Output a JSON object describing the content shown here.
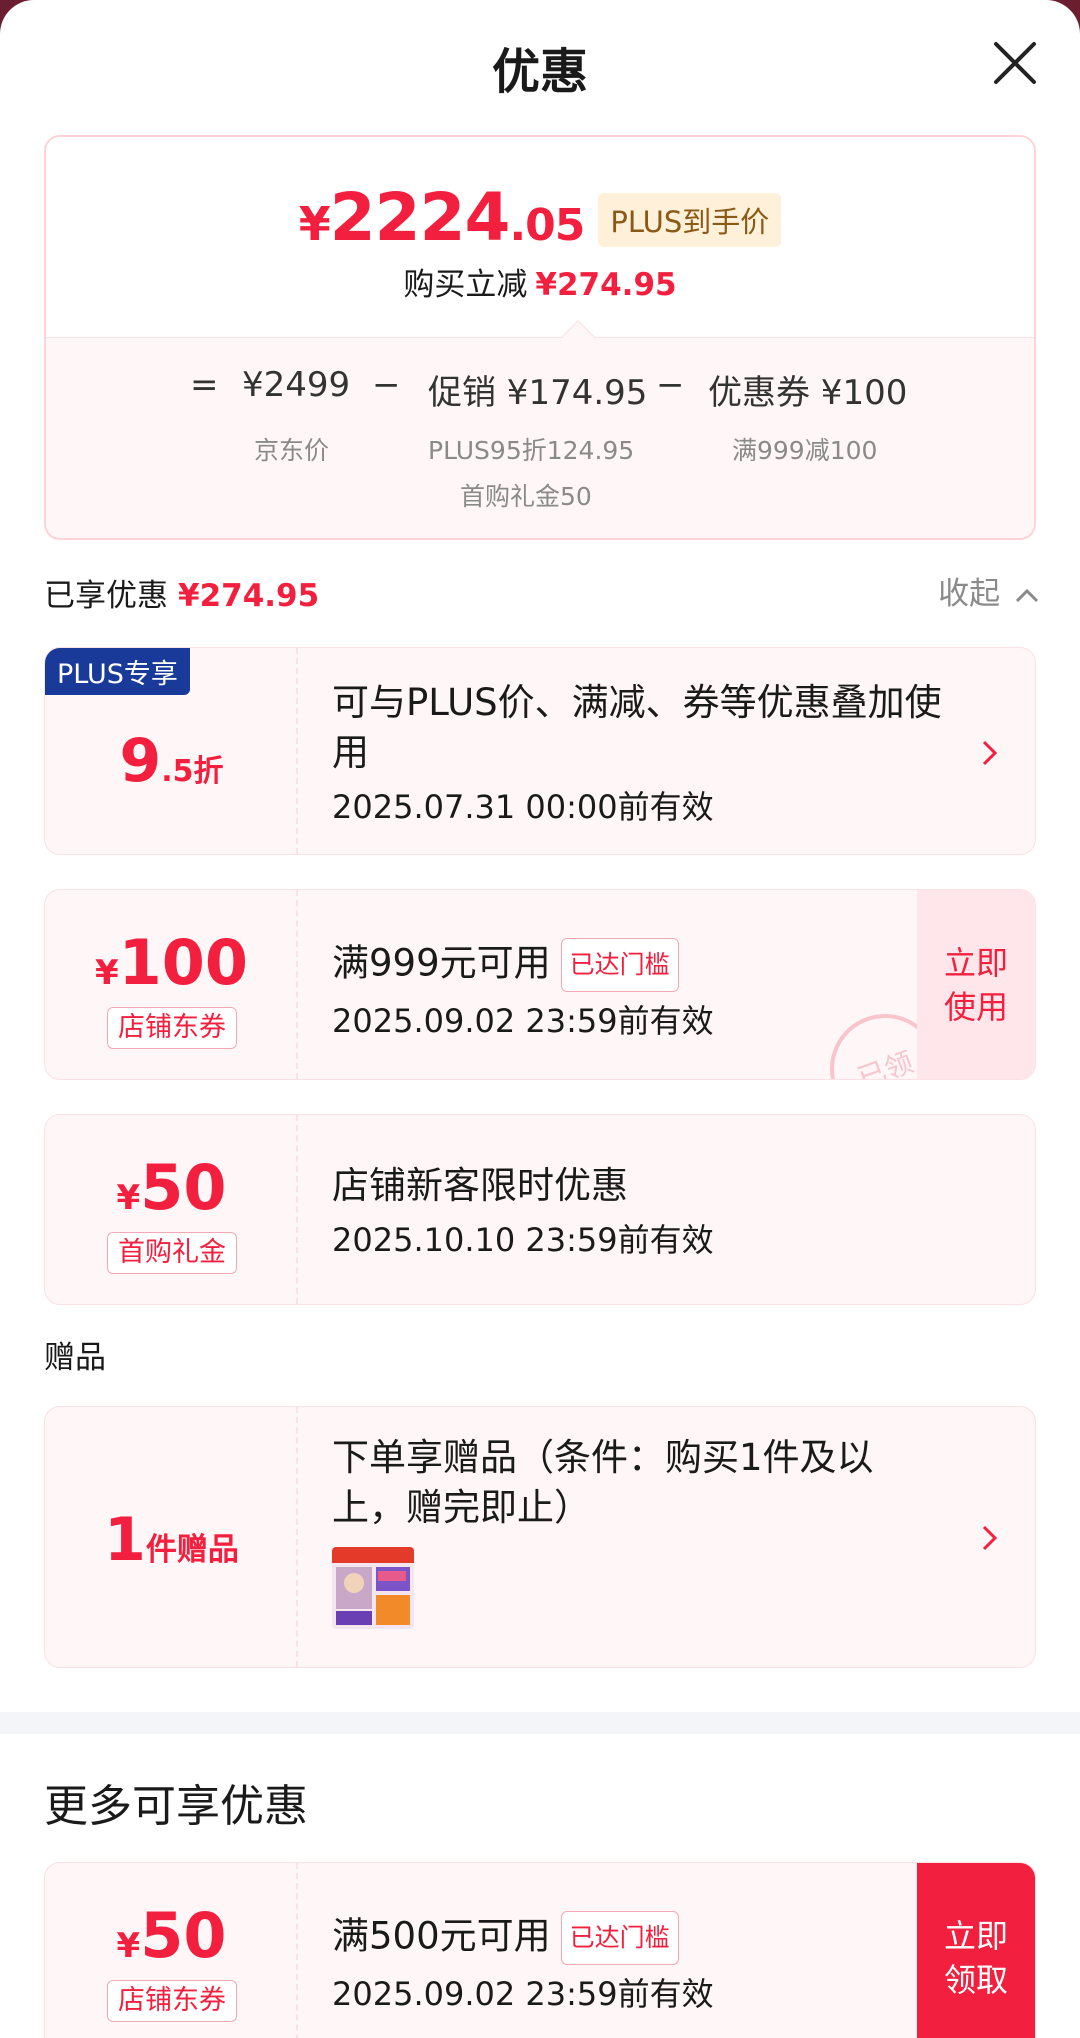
{
  "header": {
    "title": "优惠"
  },
  "summary": {
    "price_yen": "¥",
    "price_int": "2224",
    "price_dec": ".05",
    "plus_tag": "PLUS到手价",
    "reduce_label": "购买立减",
    "reduce_amount": "¥274.95",
    "formula": {
      "eq": "=",
      "jd_price": "¥2499",
      "minus1": "−",
      "promo": "促销 ¥174.95",
      "minus2": "−",
      "coupon": "优惠券 ¥100",
      "jd_price_label": "京东价",
      "promo_detail_1": "PLUS95折124.95",
      "promo_detail_2": "首购礼金50",
      "coupon_detail": "满999减100"
    }
  },
  "enjoyed": {
    "label": "已享优惠",
    "amount": "¥274.95",
    "collapse": "收起"
  },
  "cards": {
    "plus": {
      "badge": "PLUS专享",
      "discount_big": "9",
      "discount_small": ".5折",
      "title": "可与PLUS价、满减、券等优惠叠加使用",
      "date": "2025.07.31 00:00前有效"
    },
    "coupon100": {
      "yen": "¥",
      "amount": "100",
      "tag": "店铺东券",
      "title": "满999元可用",
      "reached": "已达门槛",
      "date": "2025.09.02 23:59前有效",
      "action": "立即使用",
      "stamp": "已领"
    },
    "gift50": {
      "yen": "¥",
      "amount": "50",
      "tag": "首购礼金",
      "title": "店铺新客限时优惠",
      "date": "2025.10.10 23:59前有效"
    }
  },
  "gift": {
    "section_label": "赠品",
    "count": "1",
    "count_label": "件赠品",
    "title": "下单享赠品（条件：购买1件及以上，赠完即止）"
  },
  "more": {
    "title": "更多可享优惠",
    "coupon50": {
      "yen": "¥",
      "amount": "50",
      "tag": "店铺东券",
      "title": "满500元可用",
      "reached": "已达门槛",
      "date": "2025.09.02 23:59前有效",
      "action": "立即领取"
    }
  },
  "colors": {
    "accent": "#f2203e",
    "plus_badge": "#1a3a9a",
    "card_bg": "#fff6f7"
  }
}
